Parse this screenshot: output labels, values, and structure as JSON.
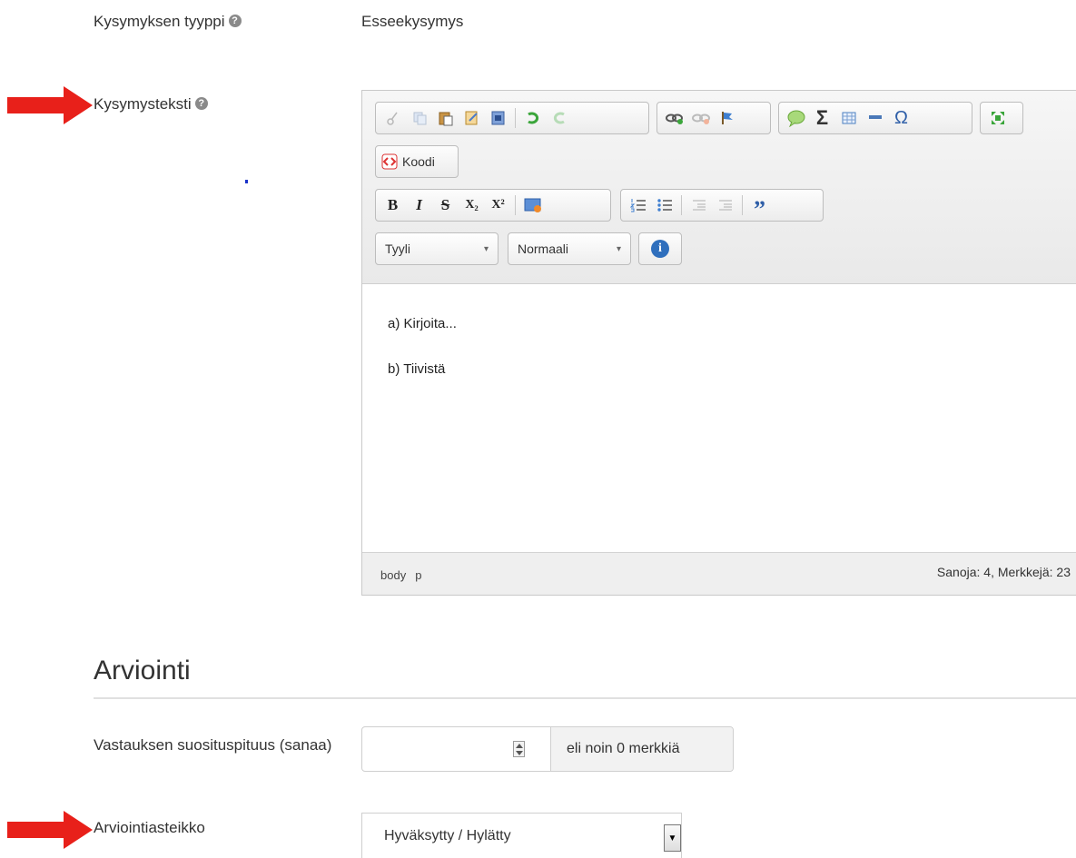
{
  "question_type": {
    "label": "Kysymyksen tyyppi",
    "help": "?",
    "value": "Esseekysymys"
  },
  "question_text": {
    "label": "Kysymysteksti",
    "help": "?"
  },
  "editor": {
    "toolbar": {
      "row1_group1": [
        "cut-icon",
        "copy-icon",
        "paste-icon",
        "paste-text-icon",
        "paste-word-icon",
        "undo-icon",
        "redo-icon"
      ],
      "row1_group2": [
        "link-icon",
        "unlink-icon",
        "anchor-icon"
      ],
      "row1_group3": [
        "comment-icon",
        "sigma-icon",
        "table-icon",
        "horizontal-rule-icon",
        "omega-icon"
      ],
      "row1_group4": [
        "maximize-icon"
      ],
      "code_button": "Koodi",
      "bold": "B",
      "italic": "I",
      "strike": "S",
      "subscript": "X₂",
      "superscript": "X²",
      "style_combo": "Tyyli",
      "format_combo": "Normaali",
      "info": "i"
    },
    "content": [
      "a) Kirjoita...",
      "b) Tiivistä"
    ],
    "status": {
      "path": [
        "body",
        "p"
      ],
      "count": "Sanoja: 4, Merkkejä: 23"
    }
  },
  "grading": {
    "heading": "Arviointi",
    "length_label": "Vastauksen suosituspituus (sanaa)",
    "length_value": "",
    "length_addon": "eli noin 0 merkkiä",
    "scale_label": "Arviointiasteikko",
    "scale_value": "Hyväksytty / Hylätty"
  },
  "colors": {
    "arrow": "#e8201a",
    "info_blue": "#2f6fbd"
  }
}
